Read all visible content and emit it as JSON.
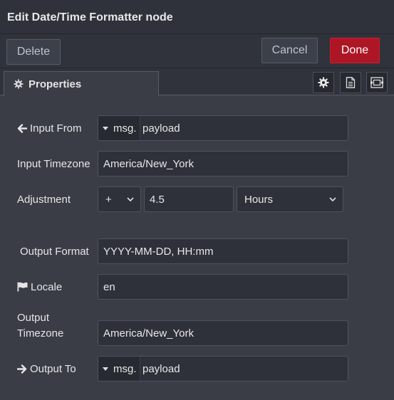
{
  "dialog": {
    "title": "Edit Date/Time Formatter node"
  },
  "toolbar": {
    "delete_label": "Delete",
    "cancel_label": "Cancel",
    "done_label": "Done"
  },
  "tabs": {
    "properties_label": "Properties"
  },
  "form": {
    "input_from": {
      "label": "Input From",
      "type": "msg.",
      "value": "payload"
    },
    "input_timezone": {
      "label": "Input Timezone",
      "value": "America/New_York"
    },
    "adjustment": {
      "label": "Adjustment",
      "sign": "+",
      "amount": "4.5",
      "unit": "Hours"
    },
    "output_format": {
      "label": "Output Format",
      "value": "YYYY-MM-DD, HH:mm"
    },
    "locale": {
      "label": "Locale",
      "value": "en"
    },
    "output_timezone": {
      "label_line1": "Output",
      "label_line2": "Timezone",
      "value": "America/New_York"
    },
    "output_to": {
      "label": "Output To",
      "type": "msg.",
      "value": "payload"
    }
  },
  "colors": {
    "done": "#ad1625",
    "background": "#3a3d46",
    "field": "#2e3139"
  }
}
